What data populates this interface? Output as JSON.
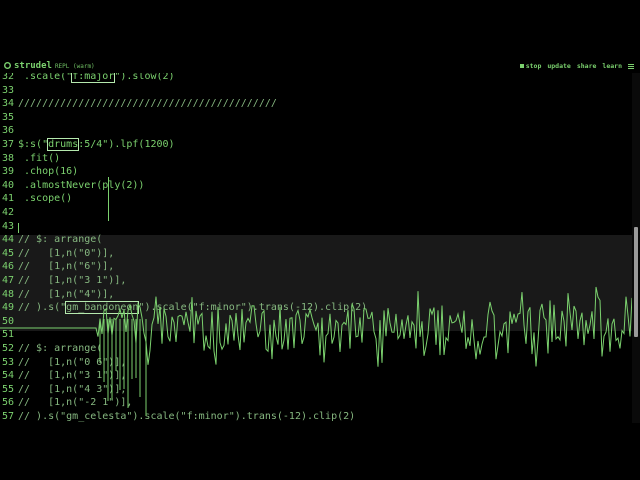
{
  "header": {
    "title": "strudel",
    "subtitle": "REPL (warm)",
    "nav": {
      "stop": "stop",
      "update": "update",
      "share": "share",
      "learn": "learn"
    }
  },
  "editor": {
    "lines": [
      {
        "n": "32",
        "code": " .scale(\"f:major\").slow(2)"
      },
      {
        "n": "33",
        "code": ""
      },
      {
        "n": "34",
        "code": "///////////////////////////////////////////"
      },
      {
        "n": "35",
        "code": ""
      },
      {
        "n": "36",
        "code": ""
      },
      {
        "n": "37",
        "code": "$:s(\"drums:5/4\").lpf(1200)"
      },
      {
        "n": "38",
        "code": " .fit()"
      },
      {
        "n": "39",
        "code": " .chop(16)"
      },
      {
        "n": "40",
        "code": " .almostNever(ply(2))"
      },
      {
        "n": "41",
        "code": " .scope()"
      },
      {
        "n": "42",
        "code": ""
      },
      {
        "n": "43",
        "code": ""
      },
      {
        "n": "44",
        "code": "// $: arrange("
      },
      {
        "n": "45",
        "code": "//   [1,n(\"0\")],"
      },
      {
        "n": "46",
        "code": "//   [1,n(\"6\")],"
      },
      {
        "n": "47",
        "code": "//   [1,n(\"3 1\")],"
      },
      {
        "n": "48",
        "code": "//   [1,n(\"4\")],"
      },
      {
        "n": "49",
        "code": "// ).s(\"gm_bandoneon\").scale(\"f:minor\").trans(-12).clip(2)"
      },
      {
        "n": "50",
        "code": ""
      },
      {
        "n": "51",
        "code": ""
      },
      {
        "n": "52",
        "code": "// $: arrange("
      },
      {
        "n": "53",
        "code": "//   [1,n(\"0 6\")],"
      },
      {
        "n": "54",
        "code": "//   [1,n(\"3 1\")],"
      },
      {
        "n": "55",
        "code": "//   [1,n(\"4 3\")],"
      },
      {
        "n": "56",
        "code": "//   [1,n(\"-2 1\")],"
      },
      {
        "n": "57",
        "code": "// ).s(\"gm_celesta\").scale(\"f:minor\").trans(-12).clip(2)"
      }
    ]
  },
  "colors": {
    "accent": "#7bd16e",
    "background": "#000000",
    "highlight_block": "#191919"
  },
  "icons": {
    "logo": "strudel-logo-icon",
    "stop": "stop-icon",
    "menu": "menu-icon"
  }
}
